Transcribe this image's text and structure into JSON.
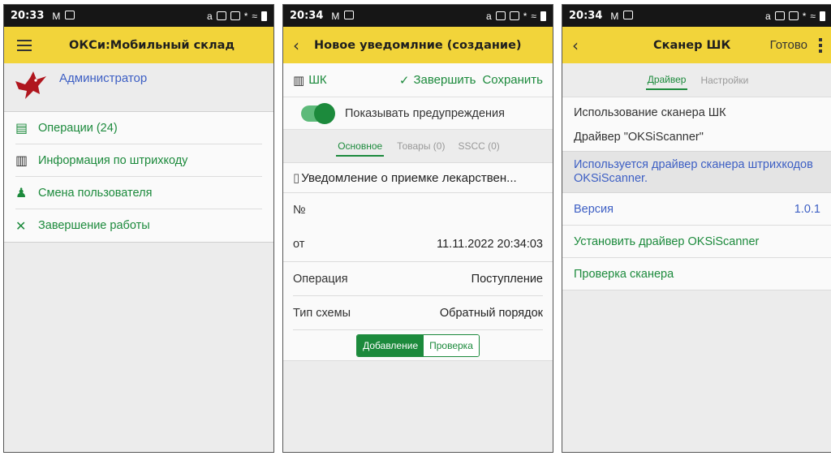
{
  "panel1": {
    "status_time": "20:33",
    "title": "ОКСи:Мобильный склад",
    "user_name": "Администратор",
    "menu": [
      {
        "label": "Операции (24)",
        "icon": "document-list-icon"
      },
      {
        "label": "Информация по штрихкоду",
        "icon": "barcode-icon"
      },
      {
        "label": "Смена пользователя",
        "icon": "user-switch-icon"
      },
      {
        "label": "Завершение работы",
        "icon": "close-x-icon"
      }
    ]
  },
  "panel2": {
    "status_time": "20:34",
    "title": "Новое уведомлние (создание)",
    "toolbar": {
      "scan_label": "ШК",
      "finish_label": "Завершить",
      "save_label": "Сохранить"
    },
    "show_warnings_label": "Показывать предупреждения",
    "show_warnings_on": true,
    "tabs": [
      "Основное",
      "Товары (0)",
      "SSCC (0)"
    ],
    "active_tab": "Основное",
    "document_title": "Уведомление о приемке лекарствен...",
    "fields": [
      {
        "label": "№",
        "value": ""
      },
      {
        "label": "от",
        "value": "11.11.2022 20:34:03"
      },
      {
        "label": "Операция",
        "value": "Поступление"
      },
      {
        "label": "Тип схемы",
        "value": "Обратный порядок"
      }
    ],
    "segment": {
      "add_label": "Добавление",
      "check_label": "Проверка",
      "selected": "Добавление"
    }
  },
  "panel3": {
    "status_time": "20:34",
    "title": "Сканер ШК",
    "done_label": "Готово",
    "tabs": [
      "Драйвер",
      "Настройки"
    ],
    "active_tab": "Драйвер",
    "usage_label": "Использование сканера ШК",
    "driver_label": "Драйвер \"OKSiScanner\"",
    "notice": "Используется драйвер сканера штрихкодов OKSiScanner.",
    "version_label": "Версия",
    "version_value": "1.0.1",
    "install_label": "Установить драйвер OKSiScanner",
    "check_label": "Проверка сканера"
  },
  "colors": {
    "appbar": "#f2d43a",
    "accent_green": "#1c8a3c",
    "link_blue": "#3d5fc4"
  }
}
